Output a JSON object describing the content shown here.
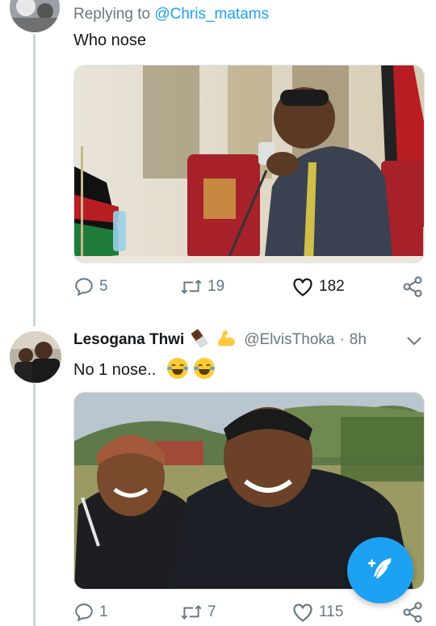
{
  "tweet1": {
    "reply_prefix": "Replying to ",
    "reply_handle": "@Chris_matams",
    "text": "Who nose",
    "actions": {
      "replies": "5",
      "retweets": "19",
      "likes": "182"
    }
  },
  "tweet2": {
    "display_name": "Lesogana Thwi",
    "name_emojis": [
      "chocolate-bar",
      "flexed-biceps"
    ],
    "handle": "@ElvisThoka",
    "separator": "·",
    "time": "8h",
    "text": "No 1 nose..",
    "text_emojis": [
      "face-with-tears-of-joy",
      "face-with-tears-of-joy"
    ],
    "actions": {
      "replies": "1",
      "retweets": "7",
      "likes": "115"
    }
  },
  "colors": {
    "accent": "#1da1f2",
    "muted": "#657786",
    "thread_line": "#ccd6dd"
  },
  "icons": [
    "reply-icon",
    "retweet-icon",
    "heart-icon",
    "share-icon",
    "chevron-down-icon",
    "compose-icon"
  ]
}
